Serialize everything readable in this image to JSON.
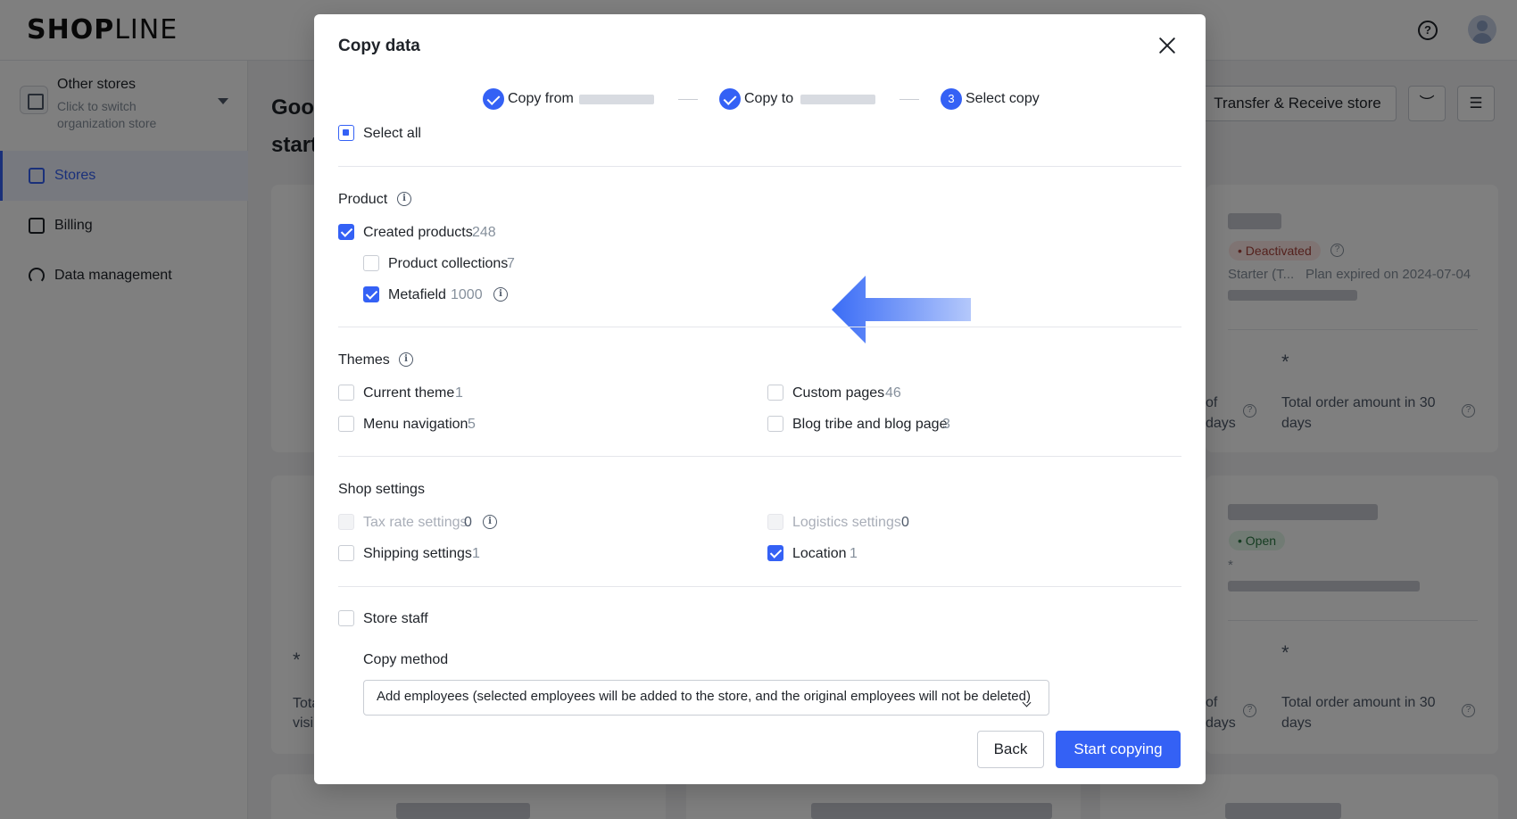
{
  "app": {
    "logo": {
      "bold": "SHOP",
      "light": "LINE",
      "text": "SHOPLINE"
    },
    "org": {
      "title": "Other stores",
      "subtitle": "Click to switch organization store"
    },
    "nav": [
      {
        "label": "Stores",
        "icon": "store-icon",
        "active": true
      },
      {
        "label": "Billing",
        "icon": "billing-icon",
        "active": false
      },
      {
        "label": "Data management",
        "icon": "gauge-icon",
        "active": false
      }
    ],
    "greeting_line1": "Goo",
    "greeting_line2": "start",
    "transfer_button": "Transfer & Receive store",
    "accent_color": "#3461f5",
    "cards": {
      "card1": {
        "status": "Deactivated",
        "plan": "Starter (T...",
        "expiry": "Plan expired on 2024-07-04",
        "stat_left_a": "of",
        "stat_left_b": "days",
        "stat_right": "Total order amount in 30 days",
        "star": "*"
      },
      "card2": {
        "status": "Open",
        "dot": "*",
        "stat_left_a": "of",
        "stat_left_b": "days",
        "stat_right": "Total order amount in 30 days",
        "star": "*",
        "left_star": "*",
        "left_text_a": "Tota",
        "left_text_b": "visi"
      }
    }
  },
  "modal": {
    "title": "Copy data",
    "steps": [
      {
        "label": "Copy from",
        "state": "done"
      },
      {
        "label": "Copy to",
        "state": "done"
      },
      {
        "number": "3",
        "label": "Select copy",
        "state": "current"
      }
    ],
    "select_all": {
      "label": "Select all",
      "state": "indeterminate"
    },
    "sections": {
      "product": {
        "title": "Product",
        "items": [
          {
            "label": "Created products",
            "count": "248",
            "checked": true
          },
          {
            "label": "Product collections",
            "count": "7",
            "checked": false
          },
          {
            "label": "Metafield",
            "count": "1000",
            "checked": true
          }
        ]
      },
      "themes": {
        "title": "Themes",
        "items": [
          {
            "label": "Current theme",
            "count": "1",
            "checked": false
          },
          {
            "label": "Custom pages",
            "count": "46",
            "checked": false
          },
          {
            "label": "Menu navigation",
            "count": "5",
            "checked": false
          },
          {
            "label": "Blog tribe and blog page",
            "count": "3",
            "checked": false
          }
        ]
      },
      "shop_settings": {
        "title": "Shop settings",
        "items": [
          {
            "label": "Tax rate settings",
            "count": "0",
            "checked": false,
            "disabled": true
          },
          {
            "label": "Logistics settings",
            "count": "0",
            "checked": false,
            "disabled": true
          },
          {
            "label": "Shipping settings",
            "count": "1",
            "checked": false
          },
          {
            "label": "Location",
            "count": "1",
            "checked": true
          }
        ]
      },
      "store_staff": {
        "label": "Store staff",
        "checked": false,
        "copy_method_label": "Copy method",
        "copy_method_value": "Add employees (selected employees will be added to the store, and the original employees will not be deleted)"
      }
    },
    "buttons": {
      "back": "Back",
      "start": "Start copying"
    }
  }
}
